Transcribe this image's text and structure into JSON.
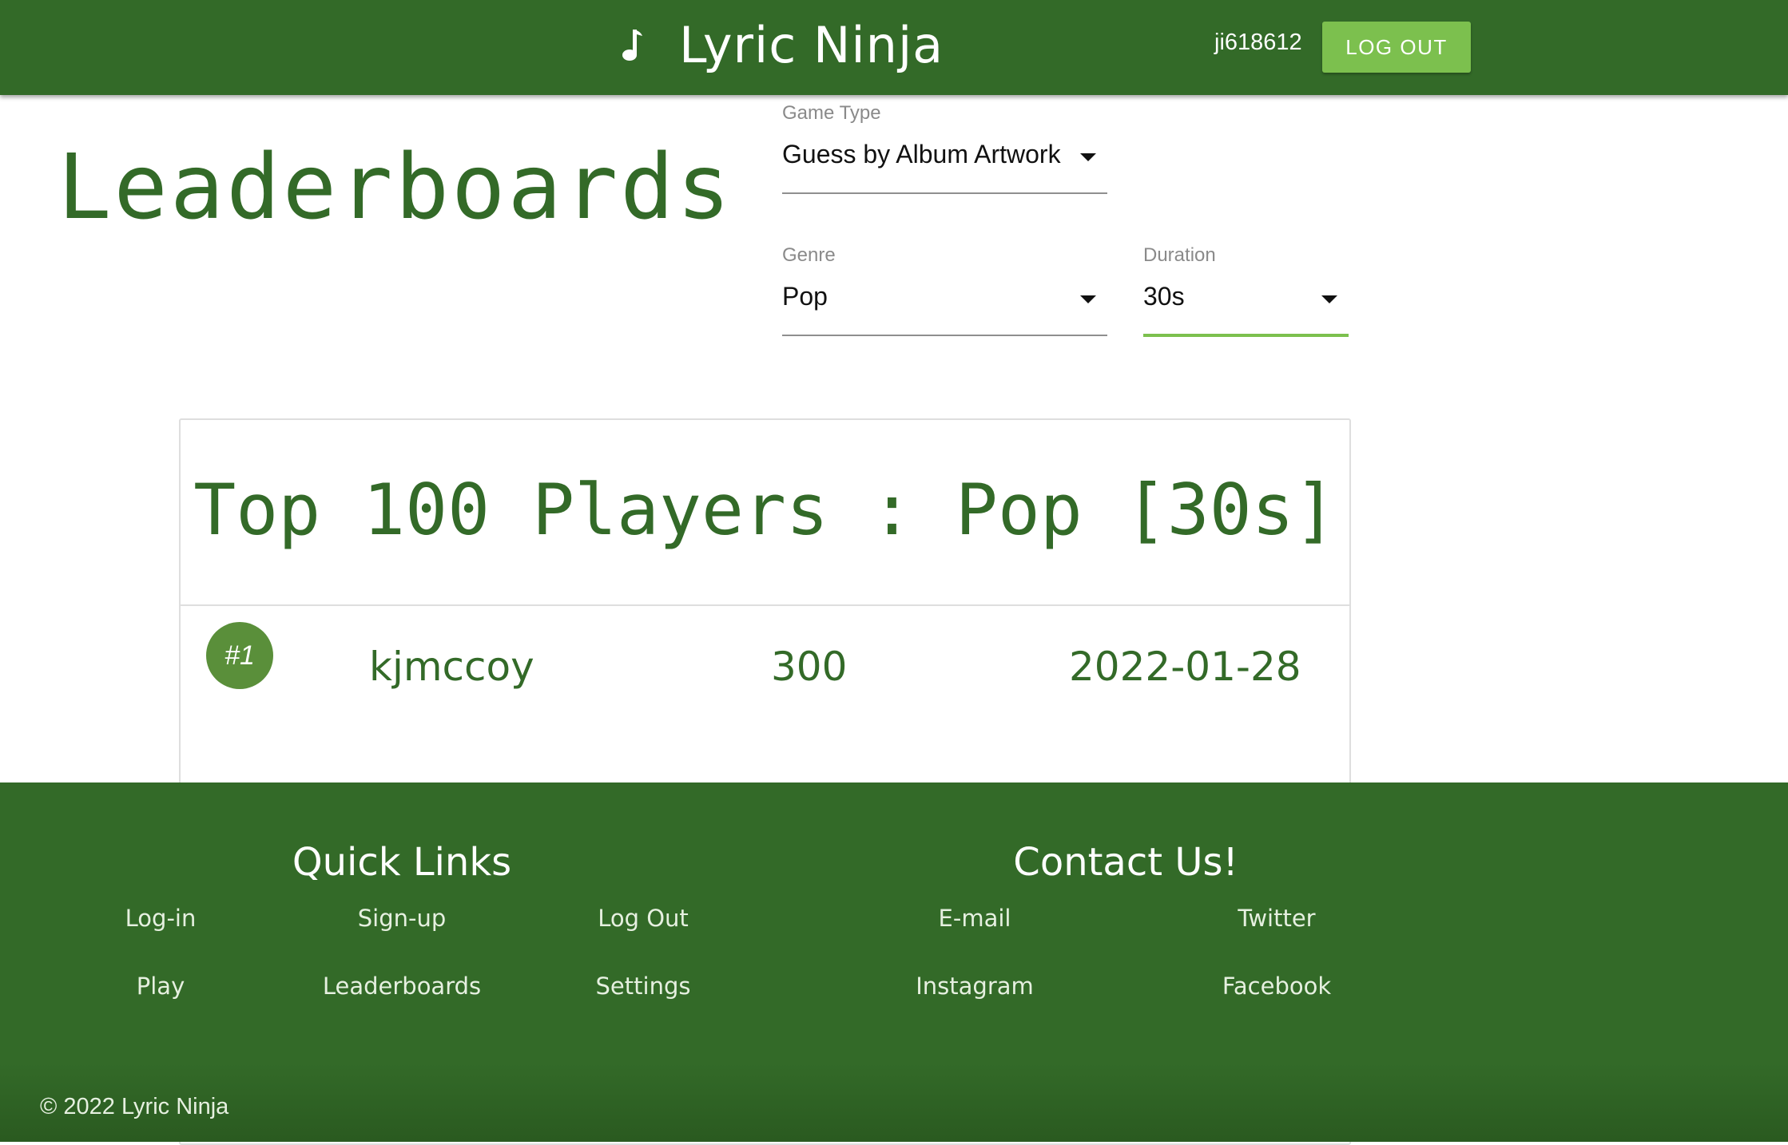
{
  "header": {
    "icon": "music-note-icon",
    "title": "Lyric Ninja",
    "username": "ji618612",
    "logout_label": "LOG OUT"
  },
  "page": {
    "title": "Leaderboards"
  },
  "filters": {
    "game_type": {
      "label": "Game Type",
      "value": "Guess by Album Artwork"
    },
    "genre": {
      "label": "Genre",
      "value": "Pop"
    },
    "duration": {
      "label": "Duration",
      "value": "30s"
    }
  },
  "leaderboard": {
    "title": "Top 100 Players : Pop [30s]",
    "rows": [
      {
        "rank": "#1",
        "player": "kjmccoy",
        "score": "300",
        "date": "2022-01-28"
      }
    ]
  },
  "footer": {
    "quick_links_heading": "Quick Links",
    "quick_links": [
      "Log-in",
      "Sign-up",
      "Log Out",
      "Play",
      "Leaderboards",
      "Settings"
    ],
    "contact_heading": "Contact Us!",
    "contact_links": [
      "E-mail",
      "Twitter",
      "Instagram",
      "Facebook"
    ],
    "copyright": "© 2022 Lyric Ninja"
  },
  "colors": {
    "primary": "#336a28",
    "accent": "#7cc04e",
    "badge": "#5a8f3a"
  }
}
